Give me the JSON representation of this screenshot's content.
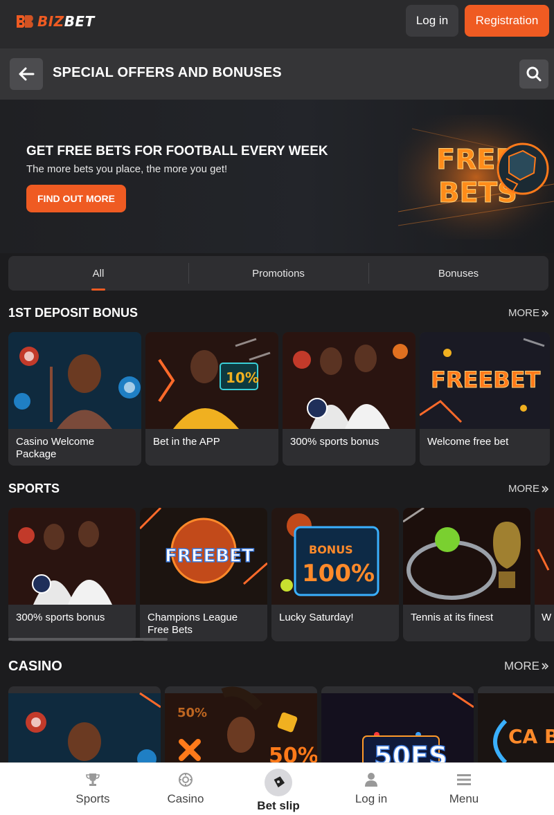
{
  "header": {
    "logo_text_biz": "BIZ",
    "logo_text_bet": "BET",
    "login_label": "Log in",
    "register_label": "Registration"
  },
  "titlebar": {
    "title": "SPECIAL OFFERS AND BONUSES",
    "back_icon": "arrow-left-icon",
    "search_icon": "search-icon"
  },
  "banner": {
    "title": "GET FREE BETS FOR FOOTBALL EVERY WEEK",
    "subtitle": "The more bets you place, the more you get!",
    "cta": "FIND OUT MORE",
    "art_line1": "FREE",
    "art_line2": "BETS"
  },
  "tabs": [
    {
      "label": "All",
      "active": true
    },
    {
      "label": "Promotions",
      "active": false
    },
    {
      "label": "Bonuses",
      "active": false
    }
  ],
  "sections": {
    "deposit": {
      "title": "1ST DEPOSIT BONUS",
      "more": "MORE",
      "cards": [
        {
          "label": "Casino Welcome Package",
          "art": "casino-host"
        },
        {
          "label": "Bet in the APP",
          "art": "app-10"
        },
        {
          "label": "300% sports bonus",
          "art": "duo"
        },
        {
          "label": "Welcome free bet",
          "art": "freebet"
        }
      ]
    },
    "sports": {
      "title": "SPORTS",
      "more": "MORE",
      "cards": [
        {
          "label": "300% sports bonus",
          "art": "duo"
        },
        {
          "label": "Champions League Free Bets",
          "art": "freebet-ball"
        },
        {
          "label": "Lucky Saturday!",
          "art": "bonus-100"
        },
        {
          "label": "Tennis at its finest",
          "art": "tennis"
        },
        {
          "label": "W",
          "art": "partial"
        }
      ]
    },
    "casino": {
      "title": "CASINO",
      "more": "MORE",
      "cards": [
        {
          "art": "casino-host",
          "text": ""
        },
        {
          "art": "fifty-percent",
          "text": "50%"
        },
        {
          "art": "fifty-fs",
          "text": "50FS"
        },
        {
          "art": "cashback",
          "text": "CA BA"
        }
      ]
    }
  },
  "bottom_nav": [
    {
      "label": "Sports",
      "icon": "trophy-icon"
    },
    {
      "label": "Casino",
      "icon": "chip-icon"
    },
    {
      "label": "Bet slip",
      "icon": "ticket-icon"
    },
    {
      "label": "Log in",
      "icon": "user-icon"
    },
    {
      "label": "Menu",
      "icon": "menu-icon"
    }
  ],
  "colors": {
    "accent": "#ef5b22",
    "background": "#1c1c1e",
    "card": "#2e2e31",
    "header": "#2a2a2c"
  }
}
